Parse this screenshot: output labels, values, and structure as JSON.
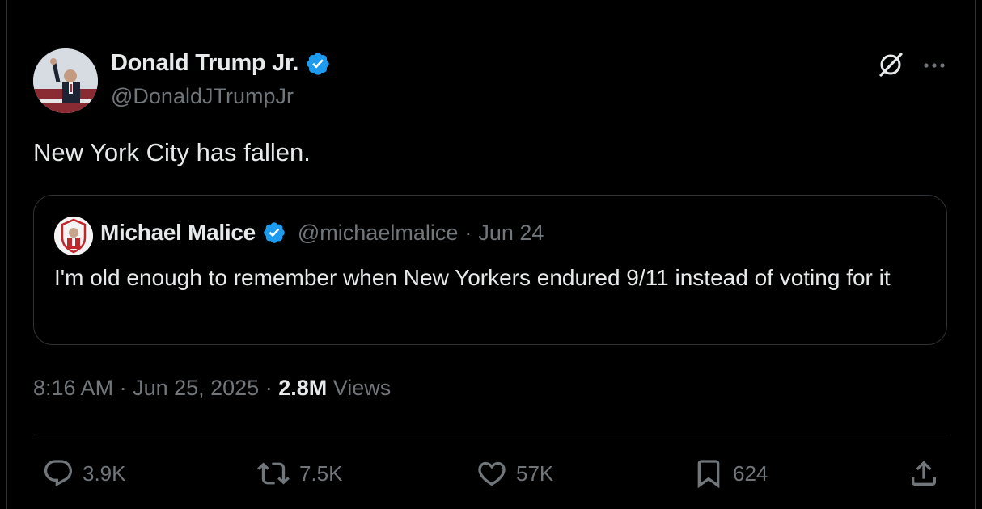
{
  "tweet": {
    "author": {
      "name": "Donald Trump Jr.",
      "handle": "@DonaldJTrumpJr",
      "verified": true
    },
    "text": "New York City has fallen.",
    "quoted": {
      "name": "Michael Malice",
      "handle": "@michaelmalice",
      "separator": "·",
      "date": "Jun 24",
      "text": "I'm old enough to remember when New Yorkers endured 9/11 instead of voting for it",
      "verified": true
    },
    "meta": {
      "time": "8:16 AM",
      "sep1": " · ",
      "date": "Jun 25, 2025",
      "sep2": " · ",
      "views_count": "2.8M",
      "views_label": " Views"
    },
    "actions": {
      "replies": "3.9K",
      "reposts": "7.5K",
      "likes": "57K",
      "bookmarks": "624"
    }
  },
  "icons": {
    "verified": "verified-badge-icon",
    "grok": "grok-icon",
    "more": "more-dots-icon",
    "reply": "reply-bubble-icon",
    "repost": "repost-arrows-icon",
    "like": "heart-icon",
    "bookmark": "bookmark-icon",
    "share": "share-upload-icon"
  },
  "colors": {
    "background": "#000000",
    "text": "#e7e9ea",
    "muted": "#71767b",
    "border": "#2f3336",
    "verified": "#1d9bf0"
  }
}
